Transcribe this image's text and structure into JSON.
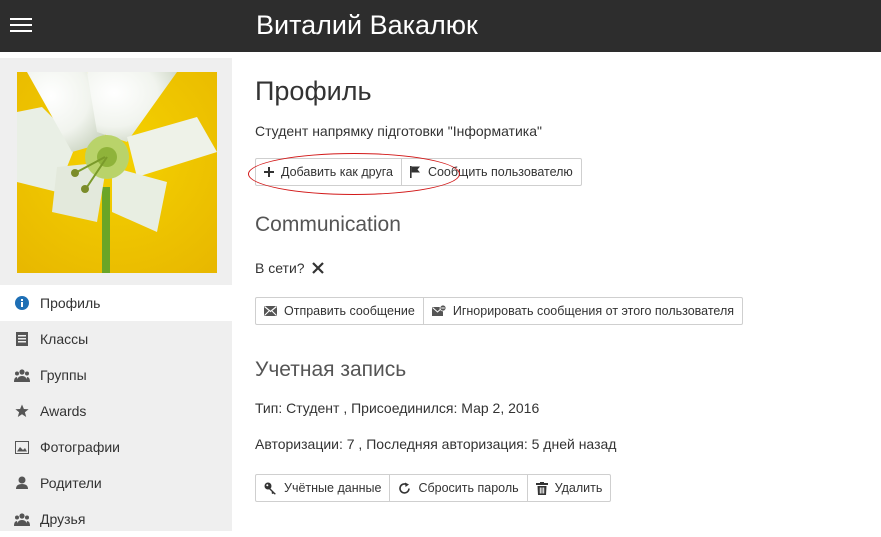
{
  "header": {
    "title": "Виталий Вакалюк",
    "menu_icon": "hamburger-icon"
  },
  "sidebar": {
    "items": [
      {
        "label": "Профиль",
        "icon": "info-icon",
        "active": true
      },
      {
        "label": "Классы",
        "icon": "notebook-icon"
      },
      {
        "label": "Группы",
        "icon": "group-icon"
      },
      {
        "label": "Awards",
        "icon": "star-icon"
      },
      {
        "label": "Фотографии",
        "icon": "photo-icon"
      },
      {
        "label": "Родители",
        "icon": "user-icon"
      },
      {
        "label": "Друзья",
        "icon": "group-icon"
      }
    ]
  },
  "profile": {
    "title": "Профиль",
    "subtitle": "Студент напрямку підготовки \"Інформатика\"",
    "buttons": {
      "add_friend": "Добавить как друга",
      "report": "Сообщить пользователю"
    }
  },
  "communication": {
    "title": "Communication",
    "online_label": "В сети?",
    "online_icon": "x-icon",
    "buttons": {
      "send_message": "Отправить сообщение",
      "ignore": "Игнорировать сообщения от этого пользователя"
    }
  },
  "account": {
    "title": "Учетная запись",
    "type_line": "Тип: Студент , Присоединился: Мар 2, 2016",
    "auth_line": "Авторизации: 7 , Последняя авторизация: 5 дней назад",
    "buttons": {
      "credentials": "Учётные данные",
      "reset_password": "Сбросить пароль",
      "delete": "Удалить"
    }
  },
  "colors": {
    "topbar": "#2d2d2d",
    "sidebar": "#efefef",
    "annotation": "#d21818",
    "info_icon": "#1e6fb5"
  }
}
